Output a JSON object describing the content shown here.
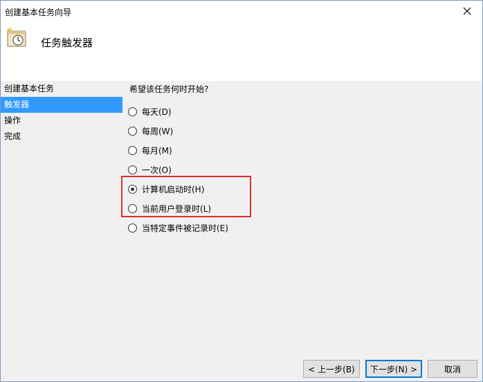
{
  "window": {
    "title": "创建基本任务向导",
    "close_glyph": "✕"
  },
  "header": {
    "title": "任务触发器",
    "icon": "task-clock-icon"
  },
  "steps": [
    {
      "label": "创建基本任务",
      "active": false
    },
    {
      "label": "触发器",
      "active": true
    },
    {
      "label": "操作",
      "active": false
    },
    {
      "label": "完成",
      "active": false
    }
  ],
  "content": {
    "question": "希望该任务何时开始?",
    "options": [
      {
        "label": "每天(D)",
        "selected": false
      },
      {
        "label": "每周(W)",
        "selected": false
      },
      {
        "label": "每月(M)",
        "selected": false
      },
      {
        "label": "一次(O)",
        "selected": false
      },
      {
        "label": "计算机启动时(H)",
        "selected": true
      },
      {
        "label": "当前用户登录时(L)",
        "selected": false
      },
      {
        "label": "当特定事件被记录时(E)",
        "selected": false
      }
    ]
  },
  "buttons": {
    "prev": "< 上一步(B)",
    "next": "下一步(N) >",
    "cancel": "取消"
  },
  "colors": {
    "highlight": "#e02b2b",
    "selection": "#3399ff",
    "panel": "#f0f0f0"
  }
}
